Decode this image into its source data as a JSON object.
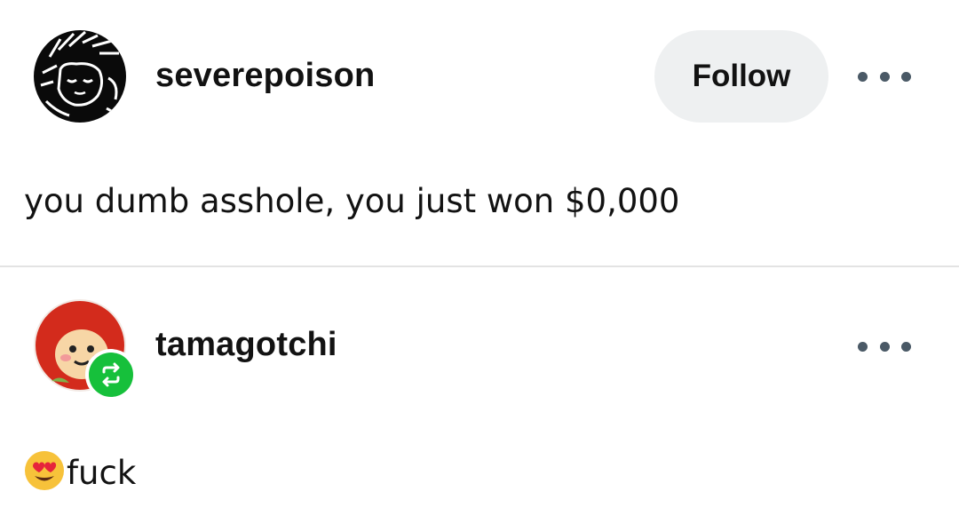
{
  "posts": [
    {
      "username": "severepoison",
      "follow_label": "Follow",
      "avatar_icon": "sketch-face-avatar",
      "text": "you dumb asshole, you just won $0,000"
    },
    {
      "username": "tamagotchi",
      "avatar_icon": "red-hooded-doll-avatar",
      "badge_icon": "reblog-icon",
      "emoji_icon": "heart-eyes-emoji",
      "text": "fuck"
    }
  ],
  "colors": {
    "follow_bg": "#eef0f1",
    "reblog_badge": "#16c03b",
    "dots": "#4a5966",
    "divider": "#e3e3e3"
  }
}
